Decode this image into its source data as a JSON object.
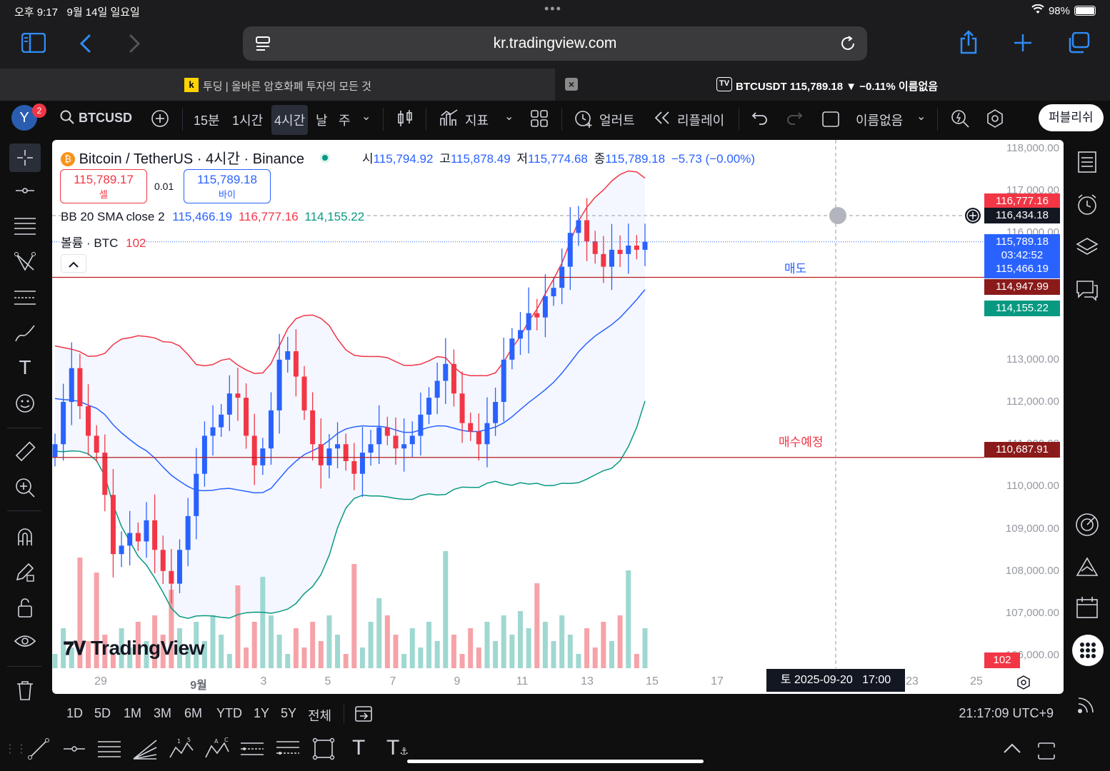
{
  "status": {
    "time": "오후 9:17",
    "date": "9월 14일 일요일",
    "battery": "98%"
  },
  "browser": {
    "url": "kr.tradingview.com"
  },
  "tabs": [
    {
      "title": "투딩 | 올바른 암호화폐 투자의 모든 것",
      "favicon": "k"
    },
    {
      "title": "BTCUSDT 115,789.18 ▼ −0.11% 이름없음"
    }
  ],
  "toolbar": {
    "avatar": "Y",
    "notif": "2",
    "symbol": "BTCUSD",
    "intervals": [
      "15분",
      "1시간",
      "4시간",
      "날",
      "주"
    ],
    "indicators": "지표",
    "alert": "얼러트",
    "replay": "리플레이",
    "layout_name": "이름없음",
    "publish": "퍼블리쉬"
  },
  "legend": {
    "title": "Bitcoin / TetherUS · 4시간 · Binance",
    "open_label": "시",
    "open": "115,794.92",
    "high_label": "고",
    "high": "115,878.49",
    "low_label": "저",
    "low": "115,774.68",
    "close_label": "종",
    "close": "115,789.18",
    "change": "−5.73 (−0.00%)",
    "sell_price": "115,789.17",
    "sell_label": "셀",
    "spread": "0.01",
    "buy_price": "115,789.18",
    "buy_label": "바이",
    "bb_label": "BB 20 SMA close 2",
    "bb_mid": "115,466.19",
    "bb_upper": "116,777.16",
    "bb_lower": "114,155.22",
    "vol_label": "볼륨 · BTC",
    "vol_value": "102"
  },
  "annotations": {
    "sell_line_label": "매도",
    "buy_line_label": "매수예정"
  },
  "price_axis": {
    "ticks": [
      "118,000.00",
      "117,000.00",
      "116,000.00",
      "113,000.00",
      "112,000.00",
      "111,000.00",
      "110,000.00",
      "109,000.00",
      "108,000.00",
      "107,000.00",
      "106,000.00"
    ],
    "labels": {
      "bb_upper": "116,777.16",
      "crosshair": "116,434.18",
      "last": "115,789.18",
      "countdown": "03:42:52",
      "bb_mid": "115,466.19",
      "sell_line": "114,947.99",
      "bb_lower": "114,155.22",
      "buy_line": "110,687.91",
      "volume": "102"
    }
  },
  "time_axis": {
    "ticks": [
      "29",
      "9월",
      "3",
      "5",
      "7",
      "9",
      "11",
      "13",
      "15",
      "17",
      "23",
      "25"
    ],
    "crosshair": "토 2025-09-20   17:00"
  },
  "branding": "TradingView",
  "range_bar": {
    "ranges": [
      "1D",
      "5D",
      "1M",
      "3M",
      "6M",
      "YTD",
      "1Y",
      "5Y",
      "전체"
    ],
    "clock": "21:17:09 UTC+9"
  },
  "colors": {
    "up": "#2962ff",
    "down": "#f23645",
    "bb_upper": "#f23645",
    "bb_lower": "#089981",
    "bb_mid": "#2962ff",
    "vol_up": "#9fd8d1",
    "vol_down": "#f5a3a8"
  },
  "chart_data": {
    "type": "candlestick",
    "symbol": "BTCUSDT",
    "interval": "4시간",
    "ylim": [
      105700,
      118200
    ],
    "x_range": [
      "2025-08-28",
      "2025-09-26"
    ],
    "horizontal_lines": [
      {
        "label": "매도",
        "price": 114947.99,
        "color": "#b71c1c"
      },
      {
        "label": "매수예정",
        "price": 110687.91,
        "color": "#b71c1c"
      }
    ],
    "close_series": [
      111000,
      112000,
      112800,
      111900,
      111200,
      110800,
      109800,
      108400,
      108600,
      108900,
      108700,
      109200,
      108500,
      108000,
      107700,
      108500,
      109300,
      110300,
      111200,
      111400,
      111700,
      112200,
      112100,
      111200,
      110500,
      110900,
      111800,
      113000,
      113200,
      112600,
      111800,
      111000,
      110500,
      110900,
      111000,
      110600,
      110300,
      110800,
      111000,
      111400,
      111200,
      110900,
      111000,
      111200,
      111700,
      112100,
      112500,
      112900,
      112200,
      111500,
      111300,
      111000,
      111500,
      112000,
      113000,
      113500,
      113700,
      114100,
      114000,
      114500,
      114700,
      115200,
      116000,
      116300,
      115800,
      115500,
      115200,
      115600,
      115500,
      115700,
      115600,
      115789
    ]
  }
}
